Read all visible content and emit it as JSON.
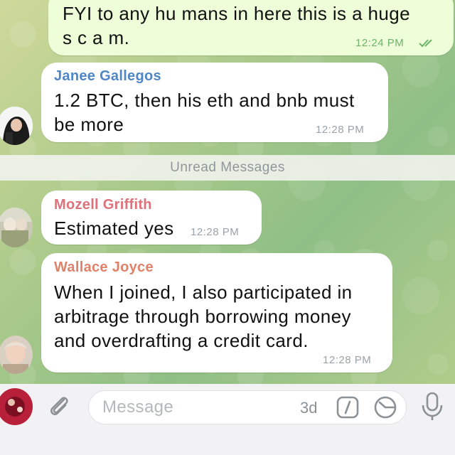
{
  "messages": [
    {
      "type": "outgoing",
      "text_line1": "FYI to any hu mans in here this is a huge",
      "text_line2": "s c a m.",
      "time": "12:24 PM"
    },
    {
      "type": "incoming",
      "sender": "Janee Gallegos",
      "sender_color": "#4f86c6",
      "text_line1": "1.2 BTC, then his eth and bnb must",
      "text_line2": "be more",
      "time": "12:28 PM"
    },
    {
      "type": "incoming",
      "sender": "Mozell Griffith",
      "sender_color": "#e0707a",
      "text_line1": "Estimated yes",
      "time": "12:28 PM"
    },
    {
      "type": "incoming",
      "sender": "Wallace Joyce",
      "sender_color": "#e0826a",
      "text_line1": "When I joined, I also participated in",
      "text_line2": "arbitrage through borrowing money",
      "text_line3": "and overdrafting a credit card.",
      "time": "12:28 PM"
    }
  ],
  "divider": {
    "label": "Unread Messages"
  },
  "composer": {
    "placeholder": "Message",
    "timer": "3d",
    "icons": [
      "attach-icon",
      "command-icon",
      "schedule-icon",
      "microphone-icon"
    ]
  },
  "colors": {
    "outgoing_bubble": "#eefed8",
    "incoming_bubble": "#ffffff",
    "read_check": "#6fb36a"
  }
}
